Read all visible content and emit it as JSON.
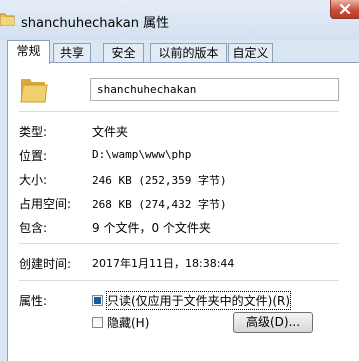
{
  "window": {
    "title": "shanchuhechakan 属性",
    "icon": "folder-icon",
    "close_icon": "close-icon"
  },
  "tabs": [
    {
      "label": "常规",
      "active": true
    },
    {
      "label": "共享",
      "active": false
    },
    {
      "label": "安全",
      "active": false
    },
    {
      "label": "以前的版本",
      "active": false
    },
    {
      "label": "自定义",
      "active": false
    }
  ],
  "general": {
    "folder_icon": "folder-icon",
    "name_value": "shanchuhechakan",
    "properties": [
      {
        "label": "类型:",
        "value": "文件夹"
      },
      {
        "label": "位置:",
        "value": "D:\\wamp\\www\\php"
      },
      {
        "label": "大小:",
        "value": "246 KB (252,359 字节)"
      },
      {
        "label": "占用空间:",
        "value": "268 KB (274,432 字节)"
      },
      {
        "label": "包含:",
        "value": "9 个文件，0 个文件夹"
      }
    ],
    "created": {
      "label": "创建时间:",
      "value": "2017年1月11日，18:38:44"
    },
    "attributes": {
      "label": "属性:",
      "readonly_label": "只读(仅应用于文件夹中的文件)(R)",
      "readonly_state": "mixed",
      "hidden_label": "隐藏(H)",
      "hidden_state": "unchecked",
      "advanced_label": "高级(D)..."
    }
  },
  "colors": {
    "accent": "#1c5a9e",
    "close": "#c9503c",
    "folder": "#e8c25a"
  }
}
